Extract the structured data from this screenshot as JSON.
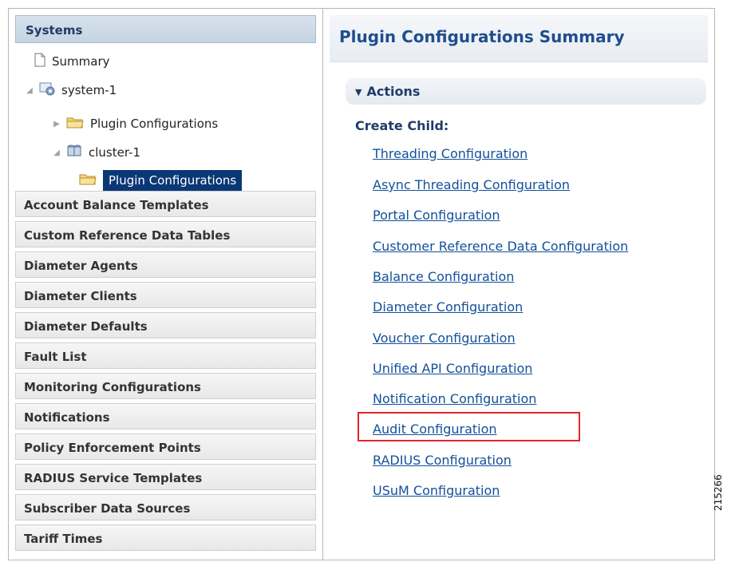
{
  "left_panel": {
    "systems_title": "Systems",
    "tree": {
      "summary": "Summary",
      "system": "system-1",
      "plugin_configurations": "Plugin Configurations",
      "cluster": "cluster-1",
      "selected_plugin_configurations": "Plugin Configurations"
    },
    "sections": [
      "Account Balance Templates",
      "Custom Reference Data Tables",
      "Diameter Agents",
      "Diameter Clients",
      "Diameter Defaults",
      "Fault List",
      "Monitoring Configurations",
      "Notifications",
      "Policy Enforcement Points",
      "RADIUS Service Templates",
      "Subscriber Data Sources",
      "Tariff Times"
    ]
  },
  "right_panel": {
    "title": "Plugin Configurations Summary",
    "actions_label": "Actions",
    "create_child_label": "Create Child:",
    "links": [
      "Threading Configuration",
      "Async Threading Configuration",
      "Portal Configuration",
      "Customer Reference Data Configuration",
      "Balance Configuration",
      "Diameter Configuration",
      "Voucher Configuration",
      "Unified API Configuration",
      "Notification Configuration",
      "Audit Configuration",
      "RADIUS Configuration",
      "USuM Configuration"
    ]
  },
  "figure_number": "215266",
  "colors": {
    "link_blue": "#12509a",
    "selected_bg": "#0a3775",
    "highlight_red": "#e2262b",
    "title_blue": "#1f4e8c"
  },
  "icons": {
    "summary": "document-icon",
    "system": "system-icon",
    "folder": "folder-icon",
    "cluster": "cluster-icon",
    "actions": "chevron-down-icon"
  }
}
